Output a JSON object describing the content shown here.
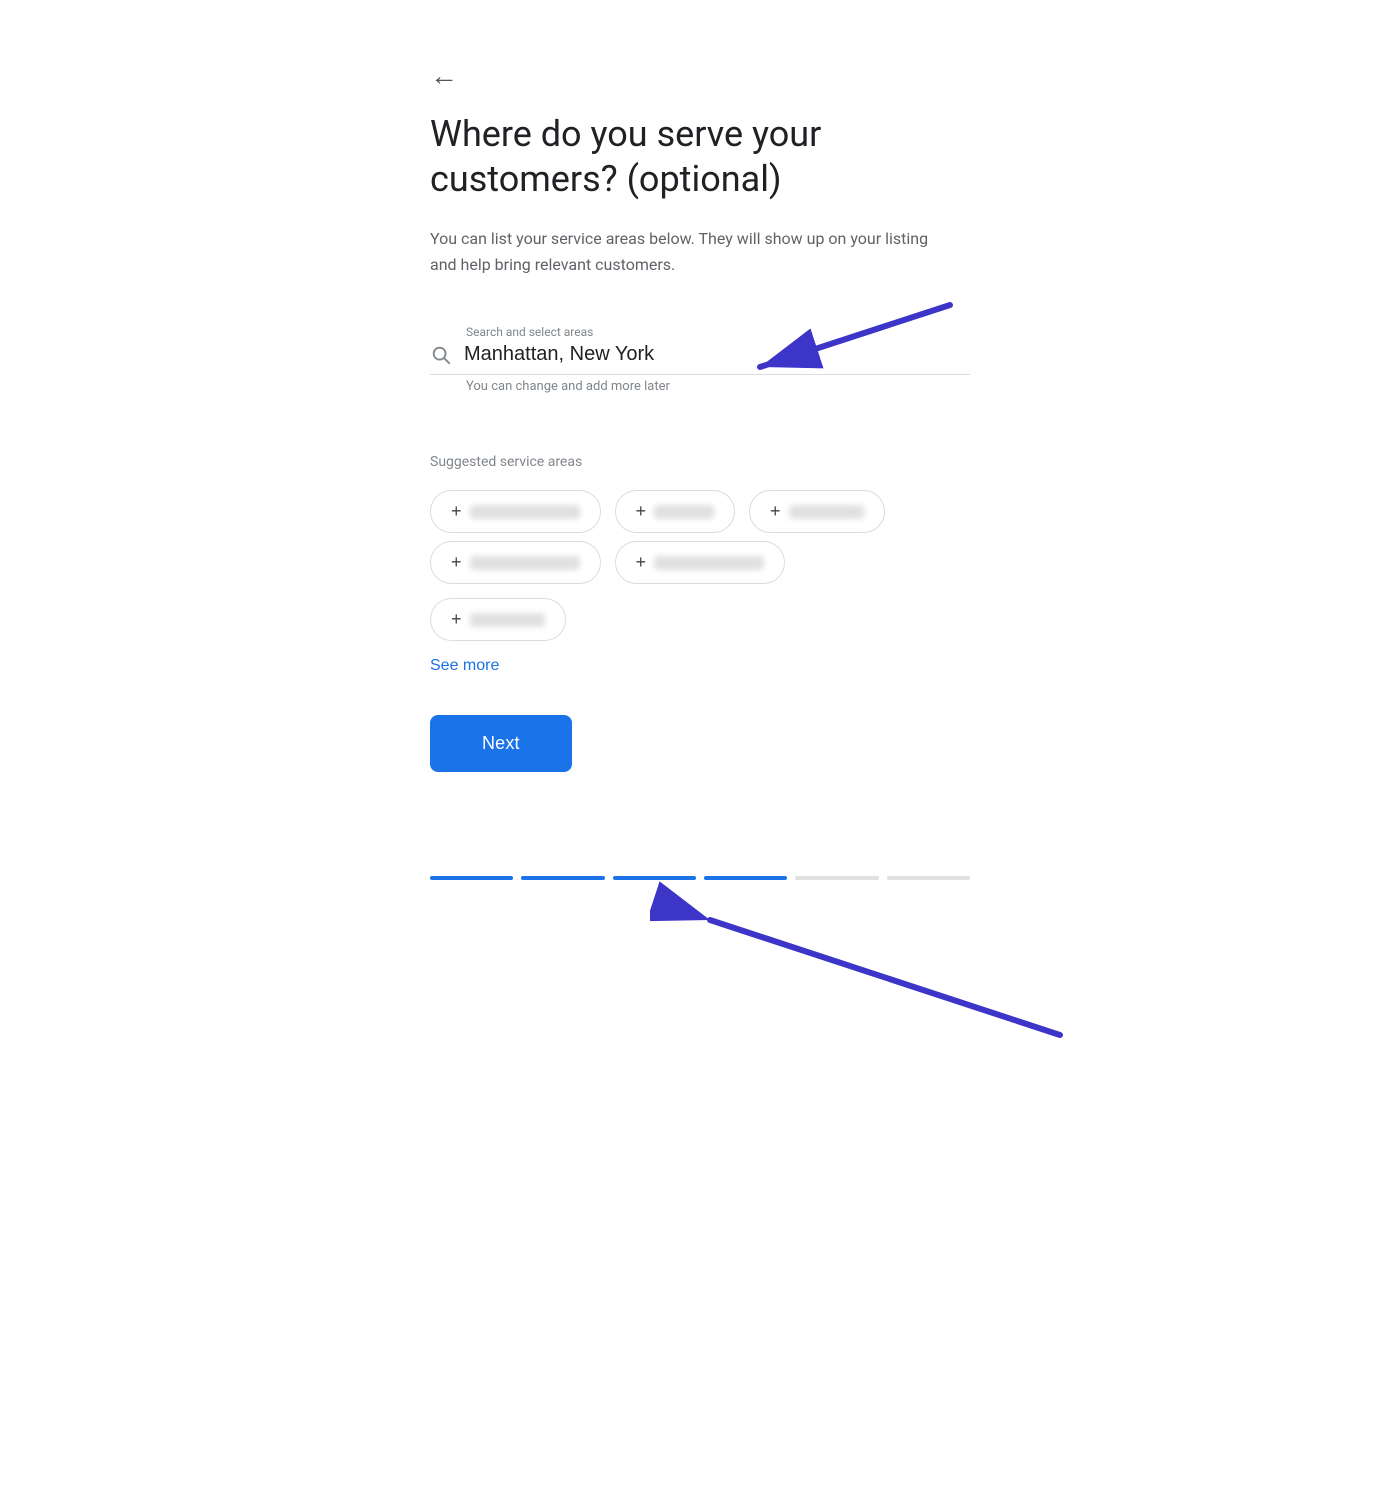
{
  "page": {
    "title": "Where do you serve your customers? (optional)",
    "subtitle": "You can list your service areas below. They will show up on your listing and help bring relevant customers.",
    "back_label": "←"
  },
  "search": {
    "label": "Search and select areas",
    "value": "Manhattan, New York",
    "hint": "You can change and add more later"
  },
  "suggested": {
    "label": "Suggested service areas",
    "chips": [
      {
        "id": 1,
        "size": "lg"
      },
      {
        "id": 2,
        "size": "sm"
      },
      {
        "id": 3,
        "size": "md"
      },
      {
        "id": 4,
        "size": "lg"
      },
      {
        "id": 5,
        "size": "lg"
      },
      {
        "id": 6,
        "size": "md"
      }
    ],
    "see_more_label": "See more"
  },
  "actions": {
    "next_label": "Next"
  },
  "progress": {
    "segments": [
      true,
      true,
      true,
      true,
      false,
      false
    ]
  }
}
